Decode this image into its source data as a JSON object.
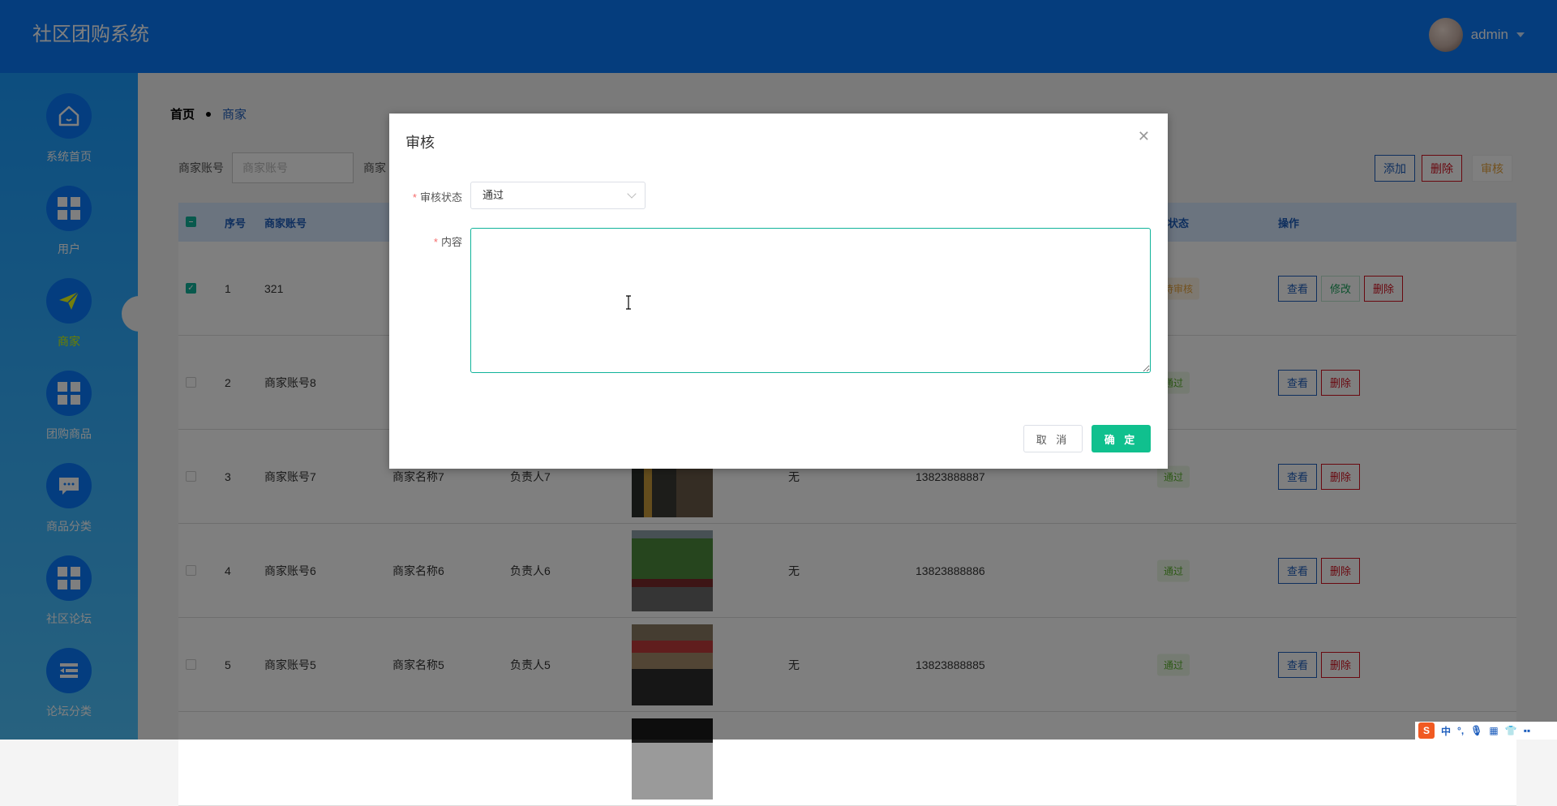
{
  "header": {
    "title": "社区团购系统",
    "user": "admin"
  },
  "sidebar": {
    "items": [
      {
        "label": "系统首页",
        "icon": "home-icon"
      },
      {
        "label": "用户",
        "icon": "grid-icon"
      },
      {
        "label": "商家",
        "icon": "paper-plane-icon",
        "active": true
      },
      {
        "label": "团购商品",
        "icon": "grid-icon"
      },
      {
        "label": "商品分类",
        "icon": "chat-icon"
      },
      {
        "label": "社区论坛",
        "icon": "grid-icon"
      },
      {
        "label": "论坛分类",
        "icon": "menu-fold-icon"
      }
    ]
  },
  "breadcrumb": {
    "home": "首页",
    "current": "商家"
  },
  "search": {
    "label1": "商家账号",
    "placeholder1": "商家账号",
    "label2": "商家"
  },
  "toolbar": {
    "add": "添加",
    "delete": "删除",
    "audit": "审核"
  },
  "table": {
    "headers": {
      "index": "序号",
      "account": "商家账号",
      "status": "核状态",
      "actions": "操作"
    },
    "rows": [
      {
        "index": "1",
        "account": "321",
        "name": "",
        "manager": "",
        "remark": "",
        "phone": "",
        "status": "待审核",
        "checked": true,
        "actions": [
          "查看",
          "修改",
          "删除"
        ]
      },
      {
        "index": "2",
        "account": "商家账号8",
        "name": "",
        "manager": "",
        "remark": "",
        "phone": "",
        "status": "通过",
        "checked": false,
        "actions": [
          "查看",
          "删除"
        ]
      },
      {
        "index": "3",
        "account": "商家账号7",
        "name": "商家名称7",
        "manager": "负责人7",
        "remark": "无",
        "phone": "13823888887",
        "status": "通过",
        "checked": false,
        "actions": [
          "查看",
          "删除"
        ]
      },
      {
        "index": "4",
        "account": "商家账号6",
        "name": "商家名称6",
        "manager": "负责人6",
        "remark": "无",
        "phone": "13823888886",
        "status": "通过",
        "checked": false,
        "actions": [
          "查看",
          "删除"
        ]
      },
      {
        "index": "5",
        "account": "商家账号5",
        "name": "商家名称5",
        "manager": "负责人5",
        "remark": "无",
        "phone": "13823888885",
        "status": "通过",
        "checked": false,
        "actions": [
          "查看",
          "删除"
        ]
      },
      {
        "index": "",
        "account": "",
        "name": "",
        "manager": "",
        "remark": "",
        "phone": "",
        "status": "",
        "checked": false,
        "actions": []
      }
    ]
  },
  "modal": {
    "title": "审核",
    "status_label": "审核状态",
    "status_value": "通过",
    "content_label": "内容",
    "content_value": "",
    "cancel": "取 消",
    "confirm": "确 定"
  },
  "ime": {
    "lang": "中",
    "punct": "°,"
  },
  "colors": {
    "header": "#0a7bfb",
    "primary": "#1e5ebd",
    "confirm": "#10c08e",
    "danger": "#d2101f",
    "warning": "#e6a23c",
    "success": "#5ab02d"
  }
}
